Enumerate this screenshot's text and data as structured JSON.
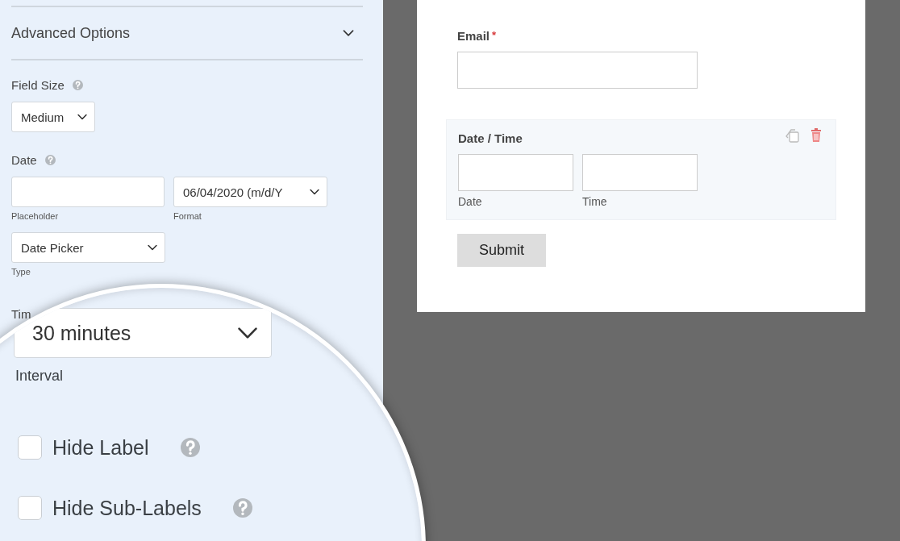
{
  "settings": {
    "section": {
      "title": "Advanced Options"
    },
    "field_size": {
      "label": "Field Size",
      "value": "Medium"
    },
    "date": {
      "label": "Date",
      "placeholder_label": "Placeholder",
      "format": {
        "value": "06/04/2020 (m/d/Y",
        "label": "Format"
      },
      "type": {
        "value": "Date Picker",
        "label": "Type"
      }
    },
    "time_label": "Tim"
  },
  "magnifier": {
    "interval": {
      "value": "30 minutes",
      "label": "Interval"
    },
    "checkboxes": [
      {
        "label": "Hide Label",
        "checked": false
      },
      {
        "label": "Hide Sub-Labels",
        "checked": false
      }
    ]
  },
  "preview": {
    "email": {
      "label": "Email",
      "required_mark": "*"
    },
    "date_time": {
      "label": "Date / Time",
      "sublabels": [
        "Date",
        "Time"
      ]
    },
    "submit": "Submit"
  }
}
